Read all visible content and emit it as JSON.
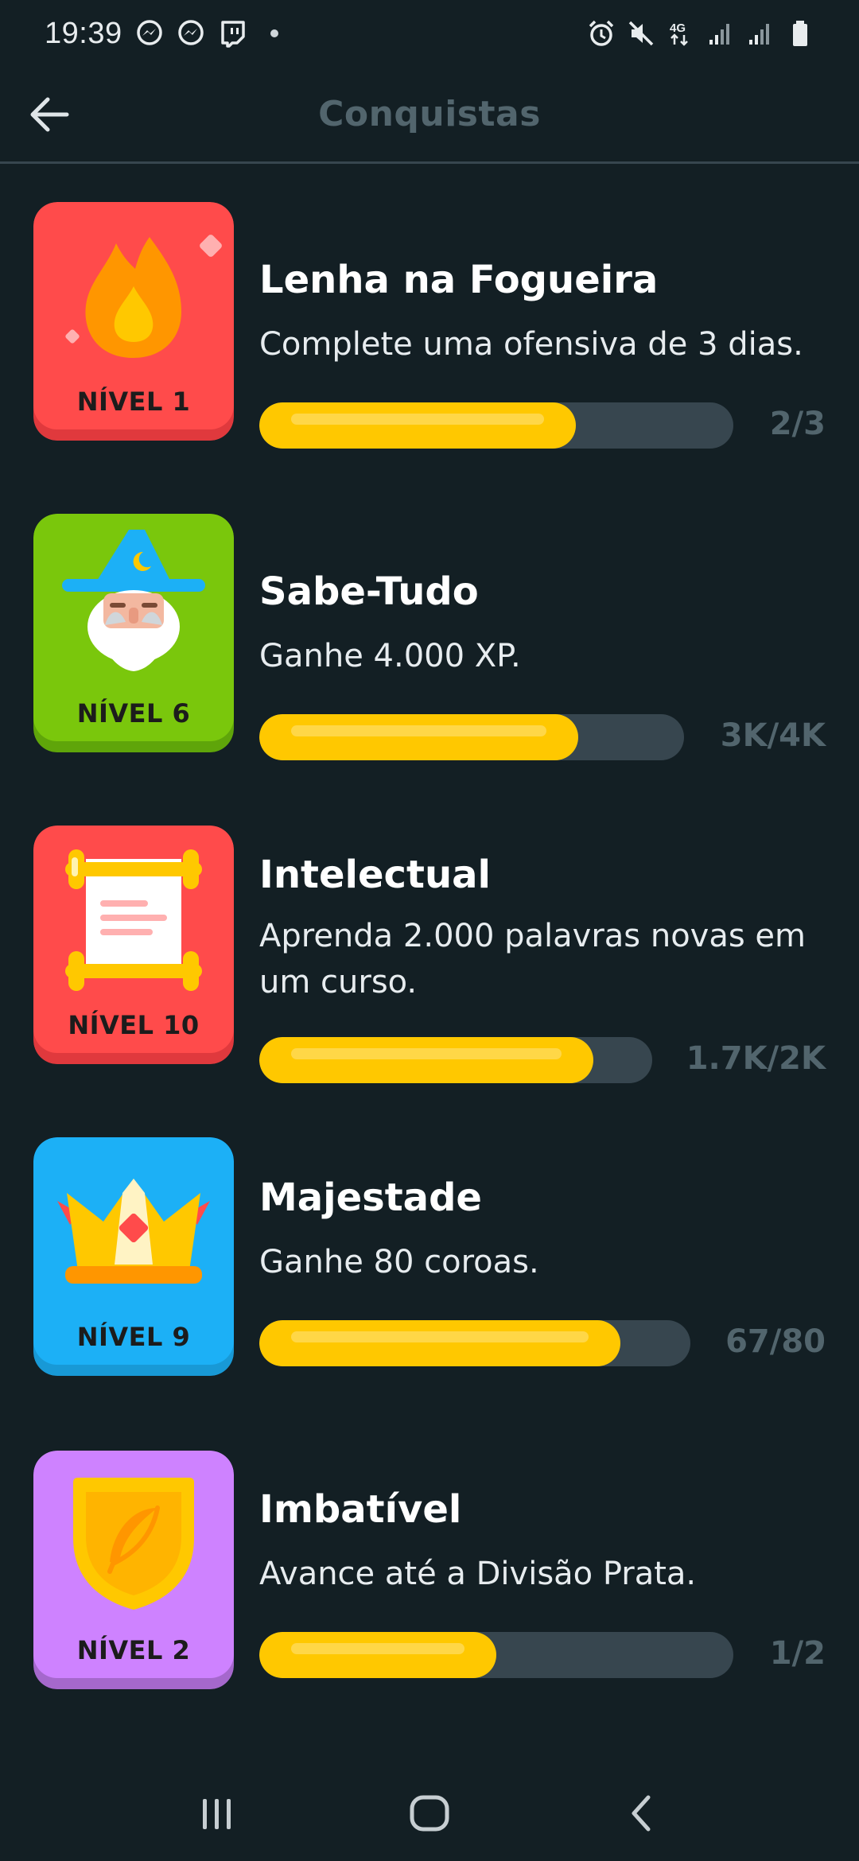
{
  "status_bar": {
    "time": "19:39",
    "left_icons": [
      "messenger-icon",
      "messenger-icon",
      "twitch-icon",
      "dot"
    ],
    "right_icons": [
      "alarm-icon",
      "mute-icon",
      "4g-icon",
      "signal-icon",
      "signal-icon",
      "battery-icon"
    ],
    "network_label": "4G"
  },
  "header": {
    "title": "Conquistas",
    "back_icon": "arrow-left-icon"
  },
  "achievements": [
    {
      "title": "Lenha na Fogueira",
      "description": "Complete uma ofensiva de 3 dias.",
      "level": "NÍVEL 1",
      "progress": 0.667,
      "count": "2/3",
      "badge_color": "#ff4b4b",
      "badge_shadow": "#e0393d",
      "icon": "fire-icon"
    },
    {
      "title": "Sabe-Tudo",
      "description": "Ganhe 4.000 XP.",
      "level": "NÍVEL 6",
      "progress": 0.75,
      "count": "3K/4K",
      "badge_color": "#7ac70c",
      "badge_shadow": "#5fa50a",
      "icon": "wizard-icon"
    },
    {
      "title": "Intelectual",
      "description": "Aprenda 2.000 palavras novas em um curso.",
      "level": "NÍVEL 10",
      "progress": 0.85,
      "count": "1.7K/2K",
      "badge_color": "#ff4b4b",
      "badge_shadow": "#e0393d",
      "icon": "scroll-icon"
    },
    {
      "title": "Majestade",
      "description": "Ganhe 80 coroas.",
      "level": "NÍVEL 9",
      "progress": 0.8375,
      "count": "67/80",
      "badge_color": "#1cb0f6",
      "badge_shadow": "#1899d6",
      "icon": "crown-icon"
    },
    {
      "title": "Imbatível",
      "description": "Avance até a Divisão Prata.",
      "level": "NÍVEL 2",
      "progress": 0.5,
      "count": "1/2",
      "badge_color": "#ce82ff",
      "badge_shadow": "#a568cc",
      "icon": "feather-shield-icon"
    }
  ],
  "nav_bar": {
    "buttons": [
      "recents-icon",
      "home-icon",
      "back-icon"
    ]
  },
  "colors": {
    "background": "#131f24",
    "progress_fill": "#ffc800",
    "progress_track": "#37464f",
    "muted_text": "#52656d"
  }
}
